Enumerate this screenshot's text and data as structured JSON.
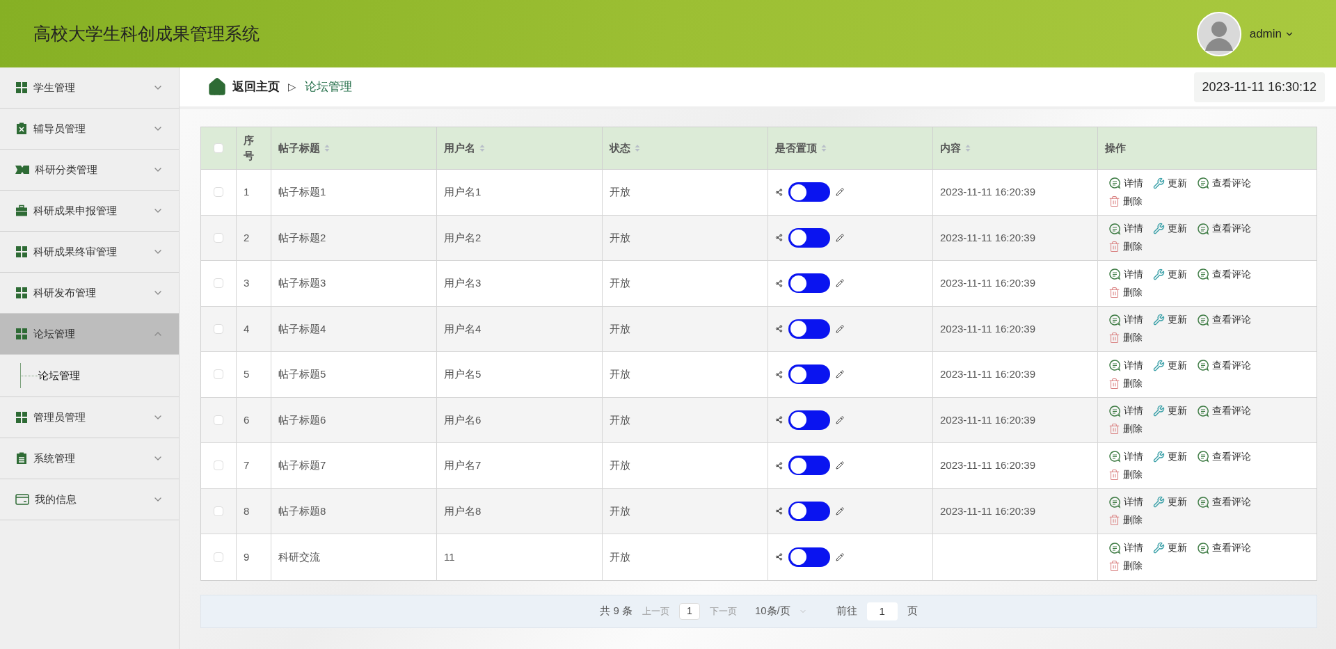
{
  "header": {
    "title": "高校大学生科创成果管理系统",
    "user": "admin"
  },
  "sidebar": {
    "items": [
      {
        "label": "学生管理",
        "kind": "grid",
        "expanded": false,
        "selected": false
      },
      {
        "label": "辅导员管理",
        "kind": "clipboard-x",
        "expanded": false,
        "selected": false
      },
      {
        "label": "科研分类管理",
        "kind": "ticket",
        "expanded": false,
        "selected": false
      },
      {
        "label": "科研成果申报管理",
        "kind": "briefcase",
        "expanded": false,
        "selected": false
      },
      {
        "label": "科研成果终审管理",
        "kind": "grid",
        "expanded": false,
        "selected": false
      },
      {
        "label": "科研发布管理",
        "kind": "grid",
        "expanded": false,
        "selected": false
      },
      {
        "label": "论坛管理",
        "kind": "grid",
        "expanded": true,
        "selected": true,
        "children": [
          {
            "label": "论坛管理"
          }
        ]
      },
      {
        "label": "管理员管理",
        "kind": "grid",
        "expanded": false,
        "selected": false
      },
      {
        "label": "系统管理",
        "kind": "clipboard",
        "expanded": false,
        "selected": false
      },
      {
        "label": "我的信息",
        "kind": "card",
        "expanded": false,
        "selected": false
      }
    ]
  },
  "breadcrumb": {
    "home": "返回主页",
    "separator": "▷",
    "current": "论坛管理"
  },
  "clock": "2023-11-11 16:30:12",
  "table": {
    "select_all_checked": false,
    "columns": [
      {
        "label": "序号",
        "sortable": false
      },
      {
        "label": "帖子标题",
        "sortable": true
      },
      {
        "label": "用户名",
        "sortable": true
      },
      {
        "label": "状态",
        "sortable": true
      },
      {
        "label": "是否置顶",
        "sortable": true
      },
      {
        "label": "内容",
        "sortable": true
      },
      {
        "label": "操作",
        "sortable": false
      }
    ],
    "rows": [
      {
        "checked": false,
        "index": "1",
        "title": "帖子标题1",
        "user": "用户名1",
        "status": "开放",
        "pinned": false,
        "content": "2023-11-11 16:20:39",
        "actions": [
          "详情",
          "更新",
          "查看评论",
          "删除"
        ]
      },
      {
        "checked": false,
        "index": "2",
        "title": "帖子标题2",
        "user": "用户名2",
        "status": "开放",
        "pinned": false,
        "content": "2023-11-11 16:20:39",
        "actions": [
          "详情",
          "更新",
          "查看评论",
          "删除"
        ]
      },
      {
        "checked": false,
        "index": "3",
        "title": "帖子标题3",
        "user": "用户名3",
        "status": "开放",
        "pinned": false,
        "content": "2023-11-11 16:20:39",
        "actions": [
          "详情",
          "更新",
          "查看评论",
          "删除"
        ]
      },
      {
        "checked": false,
        "index": "4",
        "title": "帖子标题4",
        "user": "用户名4",
        "status": "开放",
        "pinned": false,
        "content": "2023-11-11 16:20:39",
        "actions": [
          "详情",
          "更新",
          "查看评论",
          "删除"
        ]
      },
      {
        "checked": false,
        "index": "5",
        "title": "帖子标题5",
        "user": "用户名5",
        "status": "开放",
        "pinned": false,
        "content": "2023-11-11 16:20:39",
        "actions": [
          "详情",
          "更新",
          "查看评论",
          "删除"
        ]
      },
      {
        "checked": false,
        "index": "6",
        "title": "帖子标题6",
        "user": "用户名6",
        "status": "开放",
        "pinned": false,
        "content": "2023-11-11 16:20:39",
        "actions": [
          "详情",
          "更新",
          "查看评论",
          "删除"
        ]
      },
      {
        "checked": false,
        "index": "7",
        "title": "帖子标题7",
        "user": "用户名7",
        "status": "开放",
        "pinned": false,
        "content": "2023-11-11 16:20:39",
        "actions": [
          "详情",
          "更新",
          "查看评论",
          "删除"
        ]
      },
      {
        "checked": false,
        "index": "8",
        "title": "帖子标题8",
        "user": "用户名8",
        "status": "开放",
        "pinned": false,
        "content": "2023-11-11 16:20:39",
        "actions": [
          "详情",
          "更新",
          "查看评论",
          "删除"
        ]
      },
      {
        "checked": false,
        "index": "9",
        "title": "科研交流",
        "user": "11",
        "status": "开放",
        "pinned": false,
        "actions": [
          "详情",
          "更新",
          "查看评论",
          "删除"
        ]
      }
    ]
  },
  "pagination": {
    "total": "共 9 条",
    "prev": "上一页",
    "page": "1",
    "next": "下一页",
    "page_size": "10条/页",
    "goto": "前往",
    "goto_value": "1",
    "page_unit": "页"
  }
}
